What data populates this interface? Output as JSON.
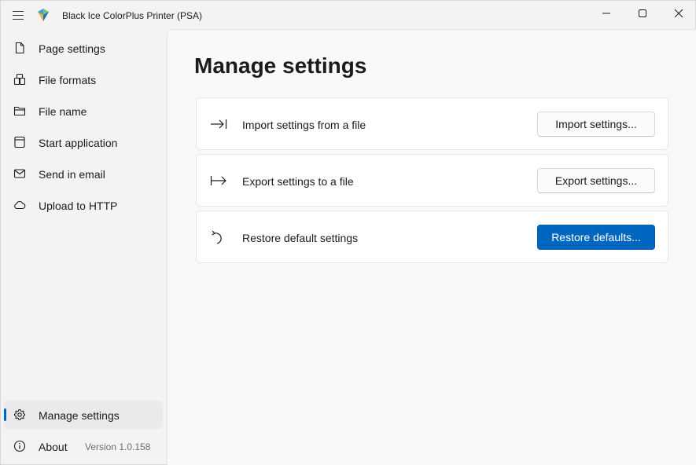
{
  "window": {
    "title": "Black Ice ColorPlus Printer (PSA)",
    "icons": {
      "menu": "hamburger-icon",
      "logo": "app-logo-icon",
      "minimize": "minimize-icon",
      "maximize": "maximize-icon",
      "close": "close-icon"
    }
  },
  "sidebar": {
    "items": [
      {
        "label": "Page settings",
        "icon": "document-icon"
      },
      {
        "label": "File formats",
        "icon": "file-formats-icon"
      },
      {
        "label": "File name",
        "icon": "folder-icon"
      },
      {
        "label": "Start application",
        "icon": "app-window-icon"
      },
      {
        "label": "Send in email",
        "icon": "mail-icon"
      },
      {
        "label": "Upload to HTTP",
        "icon": "cloud-icon"
      }
    ],
    "footer": [
      {
        "label": "Manage settings",
        "icon": "gear-icon",
        "selected": true
      },
      {
        "label": "About",
        "icon": "info-icon",
        "version": "Version 1.0.158"
      }
    ]
  },
  "main": {
    "title": "Manage settings",
    "cards": [
      {
        "label": "Import settings from a file",
        "button": "Import settings...",
        "icon": "import-arrow-icon"
      },
      {
        "label": "Export settings to a file",
        "button": "Export settings...",
        "icon": "export-arrow-icon"
      },
      {
        "label": "Restore default settings",
        "button": "Restore defaults...",
        "icon": "undo-icon"
      }
    ]
  },
  "colors": {
    "accent": "#0067c0",
    "window_bg": "#f3f3f3",
    "content_bg": "#f9f9f9",
    "card_bg": "#ffffff"
  }
}
